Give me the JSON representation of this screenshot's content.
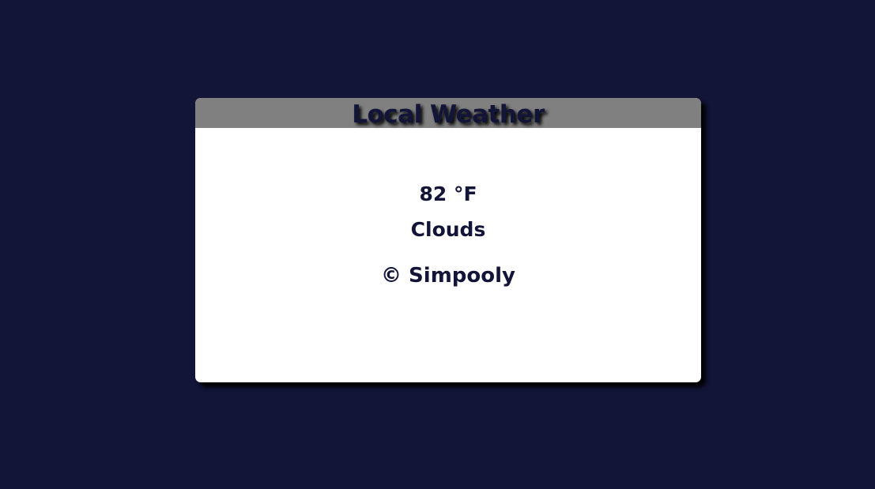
{
  "card": {
    "title": "Local Weather",
    "temperature": "82 °F",
    "condition": "Clouds",
    "copyright": "© Simpooly"
  },
  "colors": {
    "background": "#121438",
    "header": "#808080",
    "card": "#ffffff",
    "text": "#121438"
  }
}
